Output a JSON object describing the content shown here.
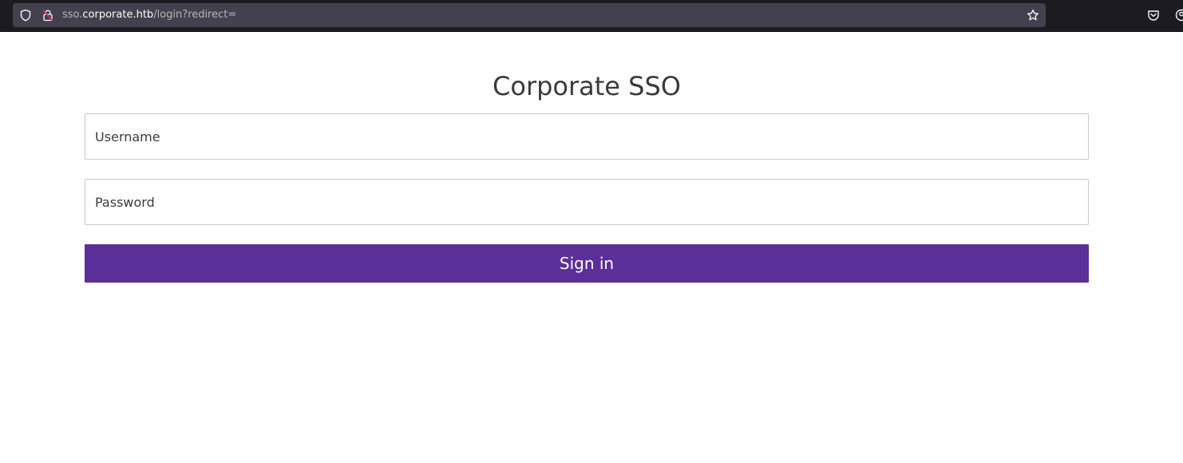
{
  "browser": {
    "url_prefix": "sso.",
    "url_host": "corporate.htb",
    "url_path": "/login?redirect="
  },
  "login": {
    "title": "Corporate SSO",
    "username_placeholder": "Username",
    "password_placeholder": "Password",
    "signin_label": "Sign in"
  },
  "colors": {
    "accent": "#5b2f98",
    "chrome": "#1c1b22"
  },
  "icons": [
    "shield-icon",
    "lock-icon",
    "star-icon",
    "pocket-icon",
    "account-icon"
  ]
}
